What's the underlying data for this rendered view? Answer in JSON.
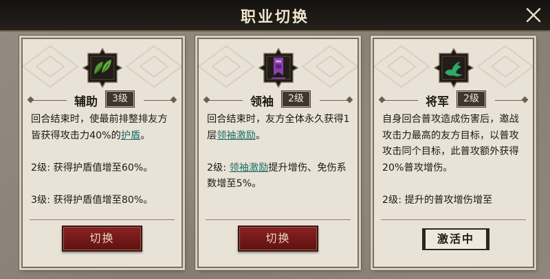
{
  "window": {
    "title": "职业切换"
  },
  "colors": {
    "accent_text": "#1d6e66",
    "button_bg": "#7a1b1b",
    "card_bg": "#e9e3d7"
  },
  "cards": [
    {
      "name": "辅助",
      "level": "3级",
      "icon": "leaf-icon",
      "desc": [
        [
          "回合结束时，使最前排整排友方皆获得攻击力40%的",
          "护盾",
          "。"
        ],
        [
          "2级: 获得护盾值增至60%。"
        ],
        [
          "3级: 获得护盾值增至80%。"
        ]
      ],
      "button": "切换"
    },
    {
      "name": "领袖",
      "level": "2级",
      "icon": "banner-icon",
      "desc_p1a": "回合结束时，友方全体永久获得1层",
      "desc_p1_link": "领袖激励",
      "desc_p1b": "。",
      "desc_p2a": "2级: ",
      "desc_p2_link": "领袖激励",
      "desc_p2b": "提升增伤、免伤系数增至5%。",
      "button": "切换"
    },
    {
      "name": "将军",
      "level": "2级",
      "icon": "dragon-icon",
      "desc_p1": "自身回合普攻造成伤害后，邀战攻击力最高的友方目标，以普攻攻击同个目标，此普攻额外获得20%普攻增伤。",
      "desc_p2": "2级: 提升的普攻增伤增至",
      "status": "激活中"
    }
  ]
}
